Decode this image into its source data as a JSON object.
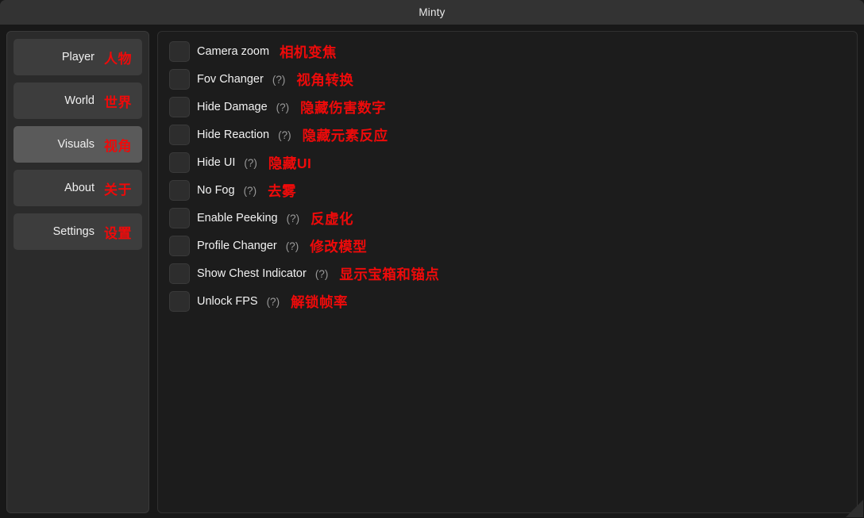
{
  "window": {
    "title": "Minty",
    "accent_red": "#ee0a0a",
    "active_nav_bg": "#5a5a5a",
    "nav_bg": "#3d3d3d",
    "sidebar_bg": "#2b2b2b",
    "panel_bg": "#1c1c1c",
    "titlebar_bg": "#333333"
  },
  "sidebar": {
    "items": [
      {
        "label_en": "Player",
        "label_cn": "人物",
        "active": false
      },
      {
        "label_en": "World",
        "label_cn": "世界",
        "active": false
      },
      {
        "label_en": "Visuals",
        "label_cn": "视角",
        "active": true
      },
      {
        "label_en": "About",
        "label_cn": "关于",
        "active": false
      },
      {
        "label_en": "Settings",
        "label_cn": "设置",
        "active": false
      }
    ]
  },
  "content": {
    "hint_marker": "(?)",
    "options": [
      {
        "label_en": "Camera zoom",
        "hint": "",
        "label_cn": "相机变焦",
        "checked": false
      },
      {
        "label_en": "Fov Changer",
        "hint": "(?)",
        "label_cn": "视角转换",
        "checked": false
      },
      {
        "label_en": "Hide Damage",
        "hint": "(?)",
        "label_cn": "隐藏伤害数字",
        "checked": false
      },
      {
        "label_en": "Hide Reaction",
        "hint": "(?)",
        "label_cn": "隐藏元素反应",
        "checked": false
      },
      {
        "label_en": "Hide UI",
        "hint": "(?)",
        "label_cn": "隐藏UI",
        "checked": false
      },
      {
        "label_en": "No Fog",
        "hint": "(?)",
        "label_cn": "去雾",
        "checked": false
      },
      {
        "label_en": "Enable Peeking",
        "hint": "(?)",
        "label_cn": "反虚化",
        "checked": false
      },
      {
        "label_en": "Profile Changer",
        "hint": "(?)",
        "label_cn": "修改模型",
        "checked": false
      },
      {
        "label_en": "Show Chest Indicator",
        "hint": "(?)",
        "label_cn": "显示宝箱和锚点",
        "checked": false
      },
      {
        "label_en": "Unlock FPS",
        "hint": "(?)",
        "label_cn": "解锁帧率",
        "checked": false
      }
    ]
  }
}
